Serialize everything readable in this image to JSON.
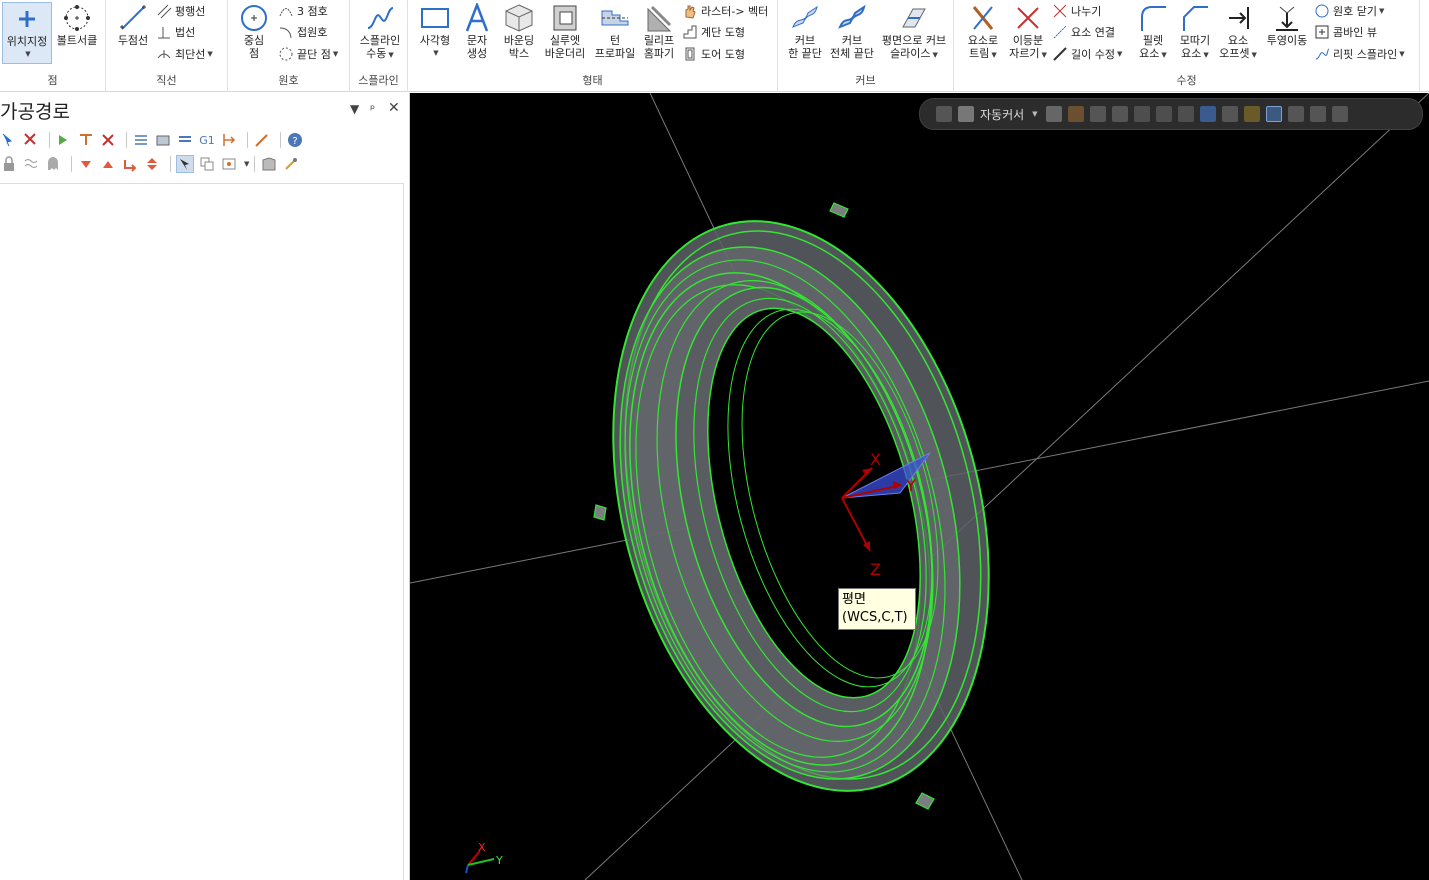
{
  "ribbon": {
    "groups": {
      "point": "점",
      "line": "직선",
      "arc": "원호",
      "spline": "스플라인",
      "shape": "형태",
      "curve": "커브",
      "modify": "수정"
    },
    "buttons": {
      "position_point": "위치지정",
      "bolt_circle": "볼트서클",
      "two_point_line": "두점선",
      "parallel_line": "평행선",
      "normal_line": "법선",
      "closest_line": "최단선",
      "center_point_1": "중심",
      "center_point_2": "점",
      "three_point_arc": "3 점호",
      "tangent_arc": "접원호",
      "end_point": "끝단 점",
      "manual_spline_1": "스플라인",
      "manual_spline_2": "수동",
      "rectangle": "사각형",
      "text_create_1": "문자",
      "text_create_2": "생성",
      "bounding_box_1": "바운딩",
      "bounding_box_2": "박스",
      "silhouette_boundary_1": "실루엣",
      "silhouette_boundary_2": "바운더리",
      "turn_profile_1": "턴",
      "turn_profile_2": "프로파일",
      "relief_groove_1": "릴리프",
      "relief_groove_2": "홈파기",
      "raster_to_vector": "라스터-> 벡터",
      "stair_shape": "계단 도형",
      "door_shape": "도어 도형",
      "curve_one_edge_1": "커브",
      "curve_one_edge_2": "한 끝단",
      "curve_all_edges_1": "커브",
      "curve_all_edges_2": "전체 끝단",
      "curve_slice_1": "평면으로 커브",
      "curve_slice_2": "슬라이스",
      "trim_by_element_1": "요소로",
      "trim_by_element_2": "트림",
      "divide_trim_1": "이등분",
      "divide_trim_2": "자르기",
      "break": "나누기",
      "join_elements": "요소 연결",
      "modify_length": "길이 수정",
      "fillet_1": "필렛",
      "fillet_2": "요소",
      "chamfer_1": "모따기",
      "chamfer_2": "요소",
      "offset_1": "요소",
      "offset_2": "오프셋",
      "project": "투영이동",
      "close_arc": "원호 닫기",
      "combine_views": "콤바인 뷰",
      "refit_spline": "리핏 스플라인"
    }
  },
  "panel": {
    "title": "가공경로"
  },
  "viewport": {
    "toolbar_autocursor": "자동커서",
    "tooltip_line1": "평면",
    "tooltip_line2": "(WCS,C,T)",
    "axis_x": "X",
    "axis_y": "Y",
    "axis_z": "Z",
    "mini_x": "X",
    "mini_y": "Y"
  },
  "colors": {
    "wire_green": "#33e633",
    "model_gray": "#5e6266",
    "axis_red": "#b00000",
    "plane_blue": "#3b4fd9",
    "viewport_bg": "#000000"
  }
}
